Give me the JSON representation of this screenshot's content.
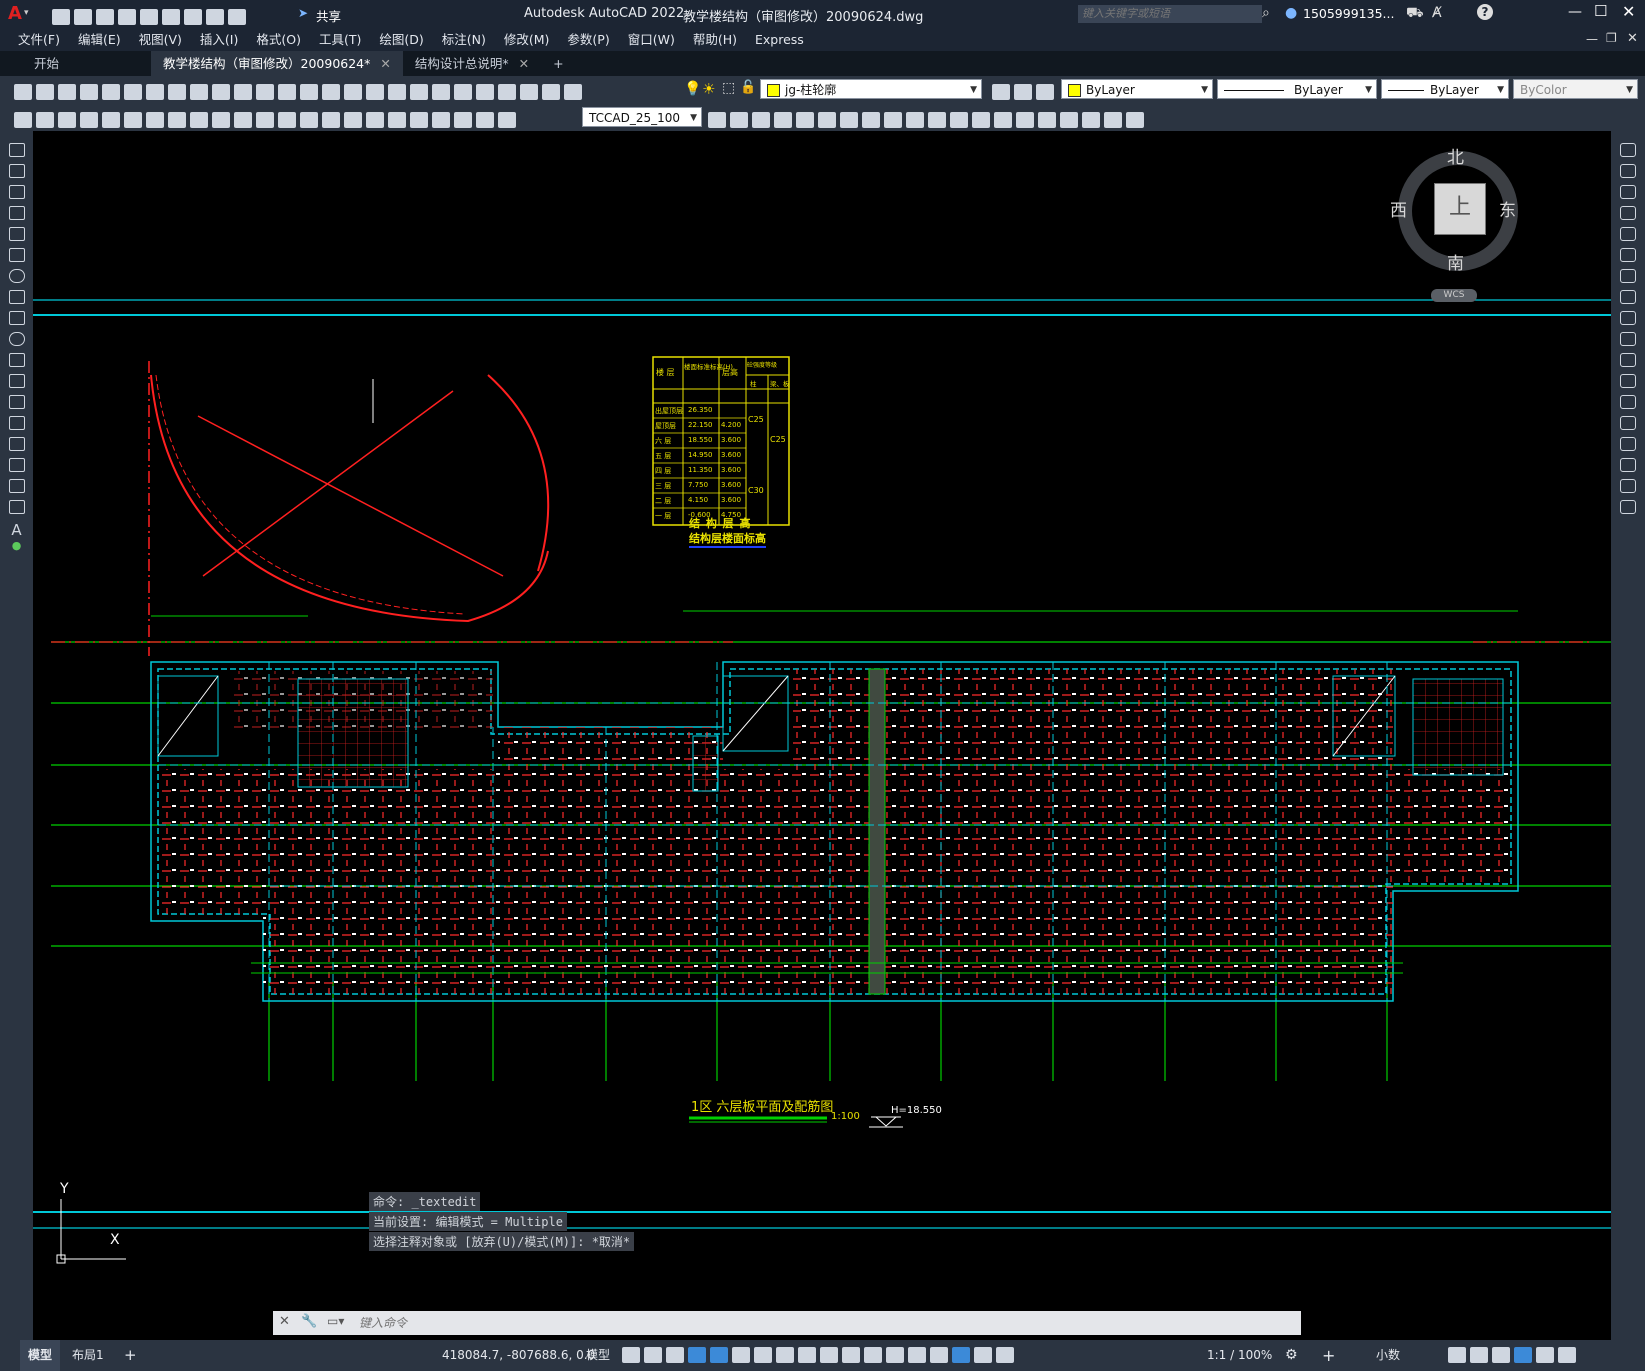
{
  "title_bar": {
    "app_title": "Autodesk AutoCAD 2022",
    "doc_title": "教学楼结构（审图修改）20090624.dwg",
    "share_label": "共享",
    "search_placeholder": "键入关键字或短语",
    "user": "1505999135...",
    "logo": "A"
  },
  "menu": [
    "文件(F)",
    "编辑(E)",
    "视图(V)",
    "插入(I)",
    "格式(O)",
    "工具(T)",
    "绘图(D)",
    "标注(N)",
    "修改(M)",
    "参数(P)",
    "窗口(W)",
    "帮助(H)",
    "Express"
  ],
  "tabs": {
    "start": "开始",
    "active": "教学楼结构（审图修改）20090624*",
    "second": "结构设计总说明*",
    "plus": "+"
  },
  "toolbar": {
    "layer": "jg-柱轮廓",
    "color": "ByLayer",
    "linetype": "ByLayer",
    "lineweight": "ByLayer",
    "plotstyle": "ByColor",
    "textstyle": "TCCAD_25_100"
  },
  "viewcube": {
    "north": "北",
    "south": "南",
    "east": "东",
    "west": "西",
    "top": "上",
    "wcs": "WCS"
  },
  "drawing": {
    "title": "1区  六层板平面及配筋图",
    "scale": "1:100",
    "elevation": "H=18.550",
    "table_caption1": "结 构 层 高",
    "table_caption2": "结构层楼面标高",
    "table_headers": [
      "楼 层",
      "楼面标准标高(H)",
      "层高",
      "砼强度等级",
      "柱",
      "梁、板"
    ],
    "table_rows": [
      [
        "出屋顶层",
        "26.350",
        "",
        ""
      ],
      [
        "屋顶层",
        "22.150",
        "4.200",
        ""
      ],
      [
        "六 层",
        "18.550",
        "3.600",
        ""
      ],
      [
        "五 层",
        "14.950",
        "3.600",
        ""
      ],
      [
        "四 层",
        "11.350",
        "3.600",
        ""
      ],
      [
        "三 层",
        "7.750",
        "3.600",
        ""
      ],
      [
        "二 层",
        "4.150",
        "3.600",
        ""
      ],
      [
        "一 层",
        "-0.600",
        "4.750",
        ""
      ]
    ],
    "table_grades": [
      "C25",
      "C25",
      "C30"
    ]
  },
  "command": {
    "line1": "命令: _textedit",
    "line2": "当前设置: 编辑模式 = Multiple",
    "line3": "选择注释对象或 [放弃(U)/模式(M)]: *取消*",
    "placeholder": "键入命令"
  },
  "ucs": {
    "x": "X",
    "y": "Y"
  },
  "status": {
    "tab_model": "模型",
    "tab_layout": "布局1",
    "coords": "418084.7, -807688.6, 0.0",
    "mode": "模型",
    "scale": "1:1 / 100%",
    "units": "小数"
  },
  "colors": {
    "cyan": "#00c8d8",
    "green": "#00d800",
    "red": "#ff2020",
    "yellow": "#e8e000",
    "white": "#ffffff"
  }
}
